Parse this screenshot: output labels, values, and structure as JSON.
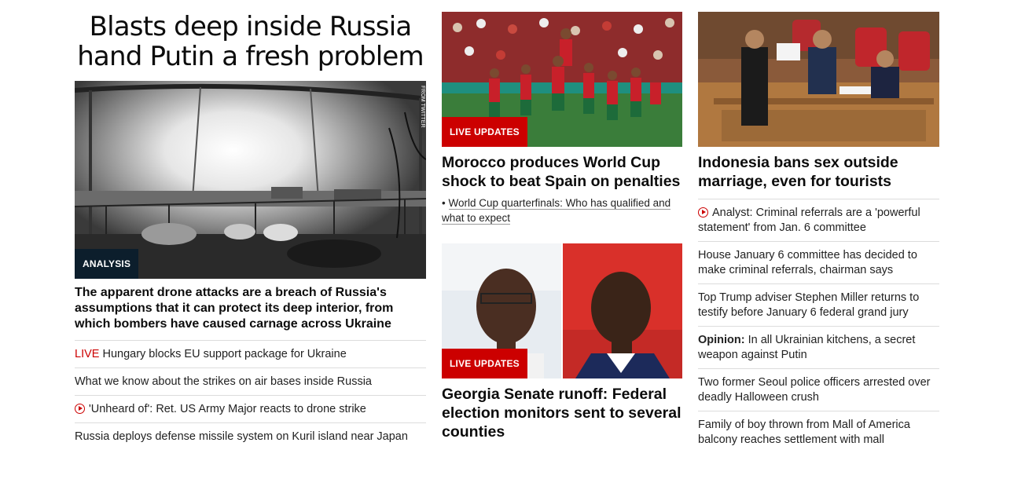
{
  "col1": {
    "headline": "Blasts deep inside Russia hand Putin a fresh problem",
    "badge": "ANALYSIS",
    "image_credit": "FROM TWITTER",
    "description": "The apparent drone attacks are a breach of Russia's assumptions that it can protect its deep interior, from which bombers have caused carnage across Ukraine",
    "items": [
      {
        "tag": "LIVE",
        "text": "Hungary blocks EU support package for Ukraine"
      },
      {
        "text": "What we know about the strikes on air bases inside Russia"
      },
      {
        "icon": "play-icon",
        "text": "'Unheard of': Ret. US Army Major reacts to drone strike"
      },
      {
        "text": "Russia deploys defense missile system on Kuril island near Japan"
      }
    ]
  },
  "col2": {
    "card1": {
      "badge": "LIVE UPDATES",
      "title": "Morocco produces World Cup shock to beat Spain on penalties",
      "sub_link": "World Cup quarterfinals: Who has qualified and what to expect",
      "bullet": "•"
    },
    "card2": {
      "badge": "LIVE UPDATES",
      "title": "Georgia Senate runoff: Federal election monitors sent to several counties"
    }
  },
  "col3": {
    "title": "Indonesia bans sex outside marriage, even for tourists",
    "items": [
      {
        "icon": "play-icon",
        "text": "Analyst: Criminal referrals are a 'powerful statement' from Jan. 6 committee"
      },
      {
        "text": "House January 6 committee has decided to make criminal referrals, chairman says"
      },
      {
        "text": "Top Trump adviser Stephen Miller returns to testify before January 6 federal grand jury"
      },
      {
        "prefix": "Opinion:",
        "text": " In all Ukrainian kitchens, a secret weapon against Putin"
      },
      {
        "text": "Two former Seoul police officers arrested over deadly Halloween crush"
      },
      {
        "text": "Family of boy thrown from Mall of America balcony reaches settlement with mall"
      }
    ]
  },
  "colors": {
    "live_red": "#cc0000",
    "analysis_navy": "#0c1e2c",
    "divider": "#dcdcdc"
  }
}
